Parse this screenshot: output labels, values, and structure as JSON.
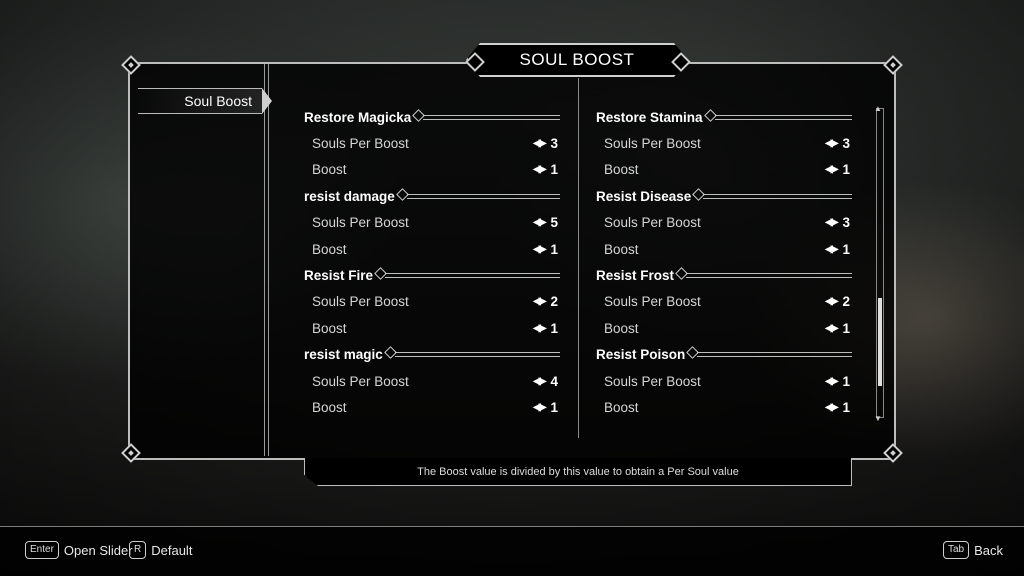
{
  "title": "SOUL BOOST",
  "sidebar": {
    "items": [
      {
        "label": "Soul Boost",
        "selected": true
      }
    ]
  },
  "left_column": [
    {
      "header": "Restore Magicka",
      "souls_label": "Souls Per Boost",
      "souls_value": "3",
      "boost_label": "Boost",
      "boost_value": "1"
    },
    {
      "header": "resist damage",
      "souls_label": "Souls Per Boost",
      "souls_value": "5",
      "boost_label": "Boost",
      "boost_value": "1"
    },
    {
      "header": "Resist Fire",
      "souls_label": "Souls Per Boost",
      "souls_value": "2",
      "boost_label": "Boost",
      "boost_value": "1"
    },
    {
      "header": "resist magic",
      "souls_label": "Souls Per Boost",
      "souls_value": "4",
      "boost_label": "Boost",
      "boost_value": "1"
    }
  ],
  "right_column": [
    {
      "header": "Restore Stamina",
      "souls_label": "Souls Per Boost",
      "souls_value": "3",
      "boost_label": "Boost",
      "boost_value": "1"
    },
    {
      "header": "Resist Disease",
      "souls_label": "Souls Per Boost",
      "souls_value": "3",
      "boost_label": "Boost",
      "boost_value": "1"
    },
    {
      "header": "Resist Frost",
      "souls_label": "Souls Per Boost",
      "souls_value": "2",
      "boost_label": "Boost",
      "boost_value": "1"
    },
    {
      "header": "Resist Poison",
      "souls_label": "Souls Per Boost",
      "souls_value": "1",
      "boost_label": "Boost",
      "boost_value": "1"
    }
  ],
  "description": "The Boost value is divided by this value to obtain a Per Soul value",
  "hints": {
    "open_slider": {
      "key": "Enter",
      "label": "Open Slider"
    },
    "default": {
      "key": "R",
      "label": "Default"
    },
    "back": {
      "key": "Tab",
      "label": "Back"
    }
  },
  "icons": {
    "slider_arrows": "double-arrow-icon"
  },
  "scroll_position": 0.6,
  "colors": {
    "frame": "#bdbdbd",
    "panel_bg": "#000000",
    "text": "#ffffff"
  }
}
